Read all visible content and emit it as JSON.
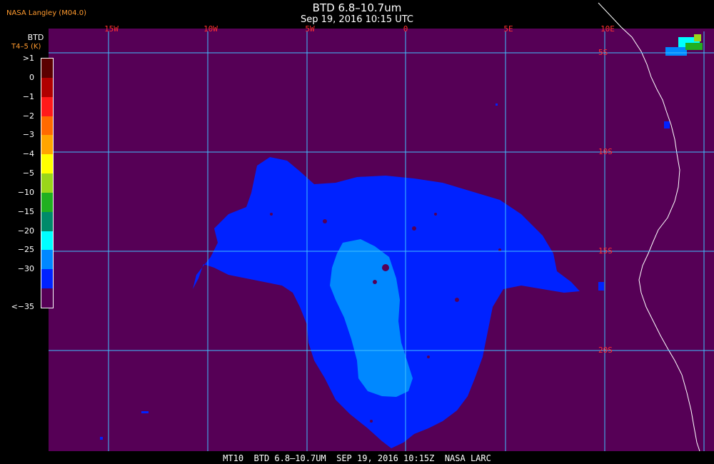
{
  "header": {
    "title": "BTD 6.8–10.7um",
    "subtitle": "Sep 19, 2016 10:15 UTC",
    "credit": "NASA Langley (M04.0)"
  },
  "legend": {
    "title": "BTD",
    "units": "T4–5 (K)",
    "items": [
      {
        "label": ">1",
        "color": "#5a0000"
      },
      {
        "label": "0",
        "color": "#b00000"
      },
      {
        "label": "−1",
        "color": "#ff1a1a"
      },
      {
        "label": "−2",
        "color": "#ff6a00"
      },
      {
        "label": "−3",
        "color": "#ffa500"
      },
      {
        "label": "−4",
        "color": "#ffff00"
      },
      {
        "label": "−5",
        "color": "#9ad61a"
      },
      {
        "label": "−10",
        "color": "#20b020"
      },
      {
        "label": "−15",
        "color": "#008a6a"
      },
      {
        "label": "−20",
        "color": "#00ffff"
      },
      {
        "label": "−25",
        "color": "#0088ff"
      },
      {
        "label": "−30",
        "color": "#0022ff"
      },
      {
        "label": "<−35",
        "color": "#560056"
      }
    ]
  },
  "map": {
    "background_color": "#560056",
    "grid_color": "#40c0ff",
    "coast_color": "#ffffff",
    "lon_labels": [
      "15W",
      "10W",
      "5W",
      "0",
      "5E",
      "10E"
    ],
    "lat_labels": [
      "5S",
      "10S",
      "15S",
      "20S"
    ]
  },
  "footer": {
    "text": "MT10  BTD 6.8–10.7UM  SEP 19, 2016 10:15Z  NASA LARC"
  }
}
